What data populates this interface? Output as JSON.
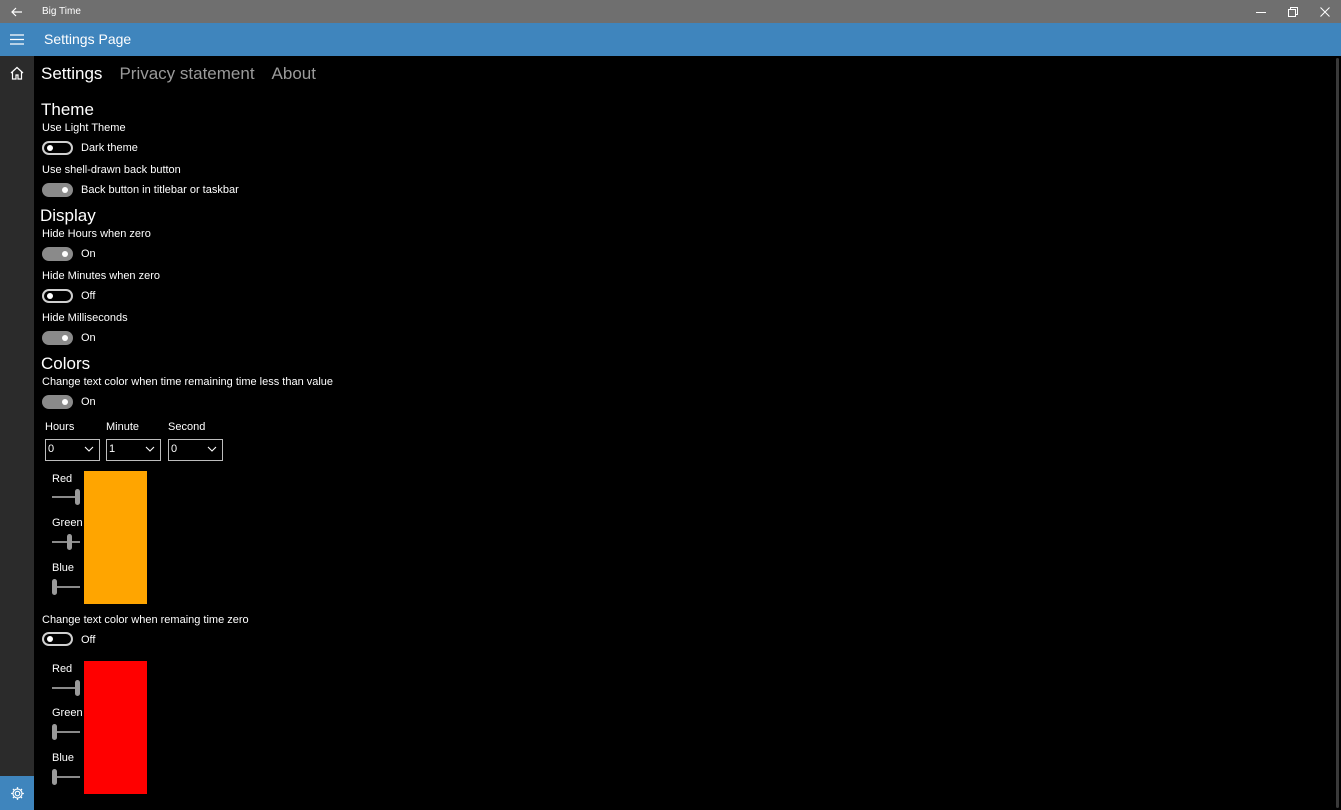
{
  "window": {
    "title": "Big Time"
  },
  "header": {
    "title": "Settings Page"
  },
  "tabs": [
    {
      "label": "Settings",
      "active": true
    },
    {
      "label": "Privacy statement",
      "active": false
    },
    {
      "label": "About",
      "active": false
    }
  ],
  "theme": {
    "heading": "Theme",
    "light_theme_label": "Use Light Theme",
    "light_theme_state": "Dark theme",
    "light_theme_on": false,
    "back_button_label": "Use shell-drawn back button",
    "back_button_state": "Back button in titlebar or taskbar",
    "back_button_on": true
  },
  "display": {
    "heading": "Display",
    "hide_hours_label": "Hide Hours when zero",
    "hide_hours_state": "On",
    "hide_hours_on": true,
    "hide_minutes_label": "Hide Minutes when zero",
    "hide_minutes_state": "Off",
    "hide_minutes_on": false,
    "hide_ms_label": "Hide Milliseconds",
    "hide_ms_state": "On",
    "hide_ms_on": true
  },
  "colors": {
    "heading": "Colors",
    "warn_label": "Change text color when time remaining time less than value",
    "warn_state": "On",
    "warn_on": true,
    "hours_label": "Hours",
    "minute_label": "Minute",
    "second_label": "Second",
    "hours_value": "0",
    "minute_value": "1",
    "second_value": "0",
    "warn_color": {
      "hex": "#ffa500",
      "red_label": "Red",
      "red": 255,
      "green_label": "Green",
      "green": 165,
      "blue_label": "Blue",
      "blue": 0
    },
    "zero_label": "Change text color when remaing time zero",
    "zero_state": "Off",
    "zero_on": false,
    "zero_color": {
      "hex": "#ff0000",
      "red_label": "Red",
      "red": 255,
      "green_label": "Green",
      "green": 0,
      "blue_label": "Blue",
      "blue": 0
    }
  },
  "icons": {
    "back": "back-arrow-icon",
    "menu": "hamburger-icon",
    "home": "home-icon",
    "settings": "gear-icon",
    "minimize": "minimize-icon",
    "restore": "restore-icon",
    "close": "close-icon",
    "dropdown": "chevron-down-icon"
  },
  "accent_color": "#3f85bd"
}
